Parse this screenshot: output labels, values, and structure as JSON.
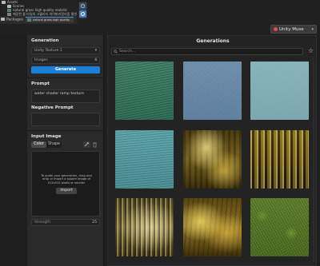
{
  "project": {
    "root": "Assets",
    "items": [
      {
        "label": "Scenes"
      },
      {
        "label": "natural grass high quality realistic"
      },
      {
        "label": "깨끗한 돌 타일의 고퀄리티 하이퍼리얼리즘 텔셋"
      }
    ],
    "packages_label": "Packages",
    "selected_asset": "natural grass high quality"
  },
  "muse": {
    "label": "Unity Muse",
    "accent": "#e44b4b"
  },
  "generation": {
    "title": "Generation",
    "model": "Unity Texture 1",
    "images_label": "Images",
    "images_value": "4",
    "generate_label": "Generate"
  },
  "prompt": {
    "title": "Prompt",
    "value": "water shader ramp texture"
  },
  "negative_prompt": {
    "title": "Negative Prompt",
    "value": ""
  },
  "input_image": {
    "title": "Input Image",
    "tabs": [
      "Color",
      "Shape"
    ],
    "active_tab": "Color",
    "hint": "To guide your generation, drag and drop or import a square image of 512x512 pixels or smaller",
    "import_label": "Import",
    "strength_label": "Strength",
    "strength_value": "25"
  },
  "generations": {
    "title": "Generations",
    "search_placeholder": "Search...",
    "tiles": [
      {
        "name": "generation-1",
        "texture": "green-water"
      },
      {
        "name": "generation-2",
        "texture": "blue-water"
      },
      {
        "name": "generation-3",
        "texture": "pale-teal"
      },
      {
        "name": "generation-4",
        "texture": "teal-water"
      },
      {
        "name": "generation-5",
        "texture": "gold-gloss"
      },
      {
        "name": "generation-6",
        "texture": "gold-drips"
      },
      {
        "name": "generation-7",
        "texture": "gold-stripes"
      },
      {
        "name": "generation-8",
        "texture": "gold-foil"
      },
      {
        "name": "generation-9",
        "texture": "grass"
      }
    ]
  },
  "colors": {
    "generate_button": "#1a7fd6",
    "panel": "#2a2a2a",
    "background": "#1e1e1e"
  }
}
